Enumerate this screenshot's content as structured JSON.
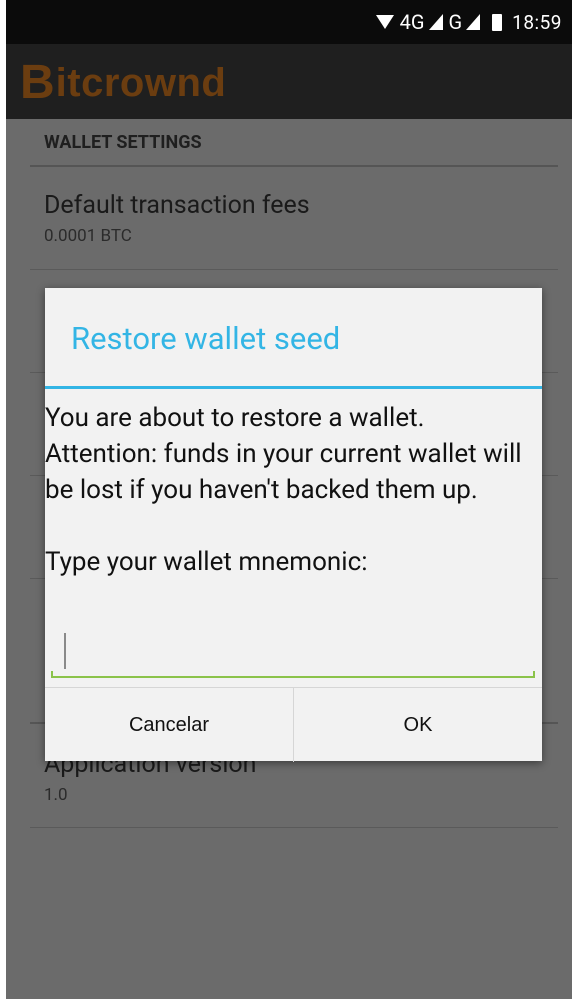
{
  "status_bar": {
    "network_label": "4G",
    "network_label_2": "G",
    "time": "18:59"
  },
  "app_bar": {
    "logo_mark": "B",
    "logo_text": "itcrownd",
    "logo_color": "#6b3d10"
  },
  "settings": {
    "section_header": "WALLET SETTINGS",
    "items": [
      {
        "title": "Default transaction fees",
        "summary": "0.0001 BTC"
      }
    ],
    "about": {
      "title": "Application version",
      "summary": "1.0"
    }
  },
  "dialog": {
    "title": "Restore wallet seed",
    "message": "You are about to restore a wallet.\nAttention: funds in your current wallet will be lost if you haven't backed them up.\n\nType your wallet mnemonic:",
    "input_value": "",
    "buttons": {
      "cancel_label": "Cancelar",
      "ok_label": "OK"
    },
    "accent_color": "#33b5e5",
    "input_accent_color": "#8bc34a"
  },
  "icons": {
    "wifi": "wifi-icon",
    "signal": "signal-icon",
    "battery": "battery-icon"
  }
}
